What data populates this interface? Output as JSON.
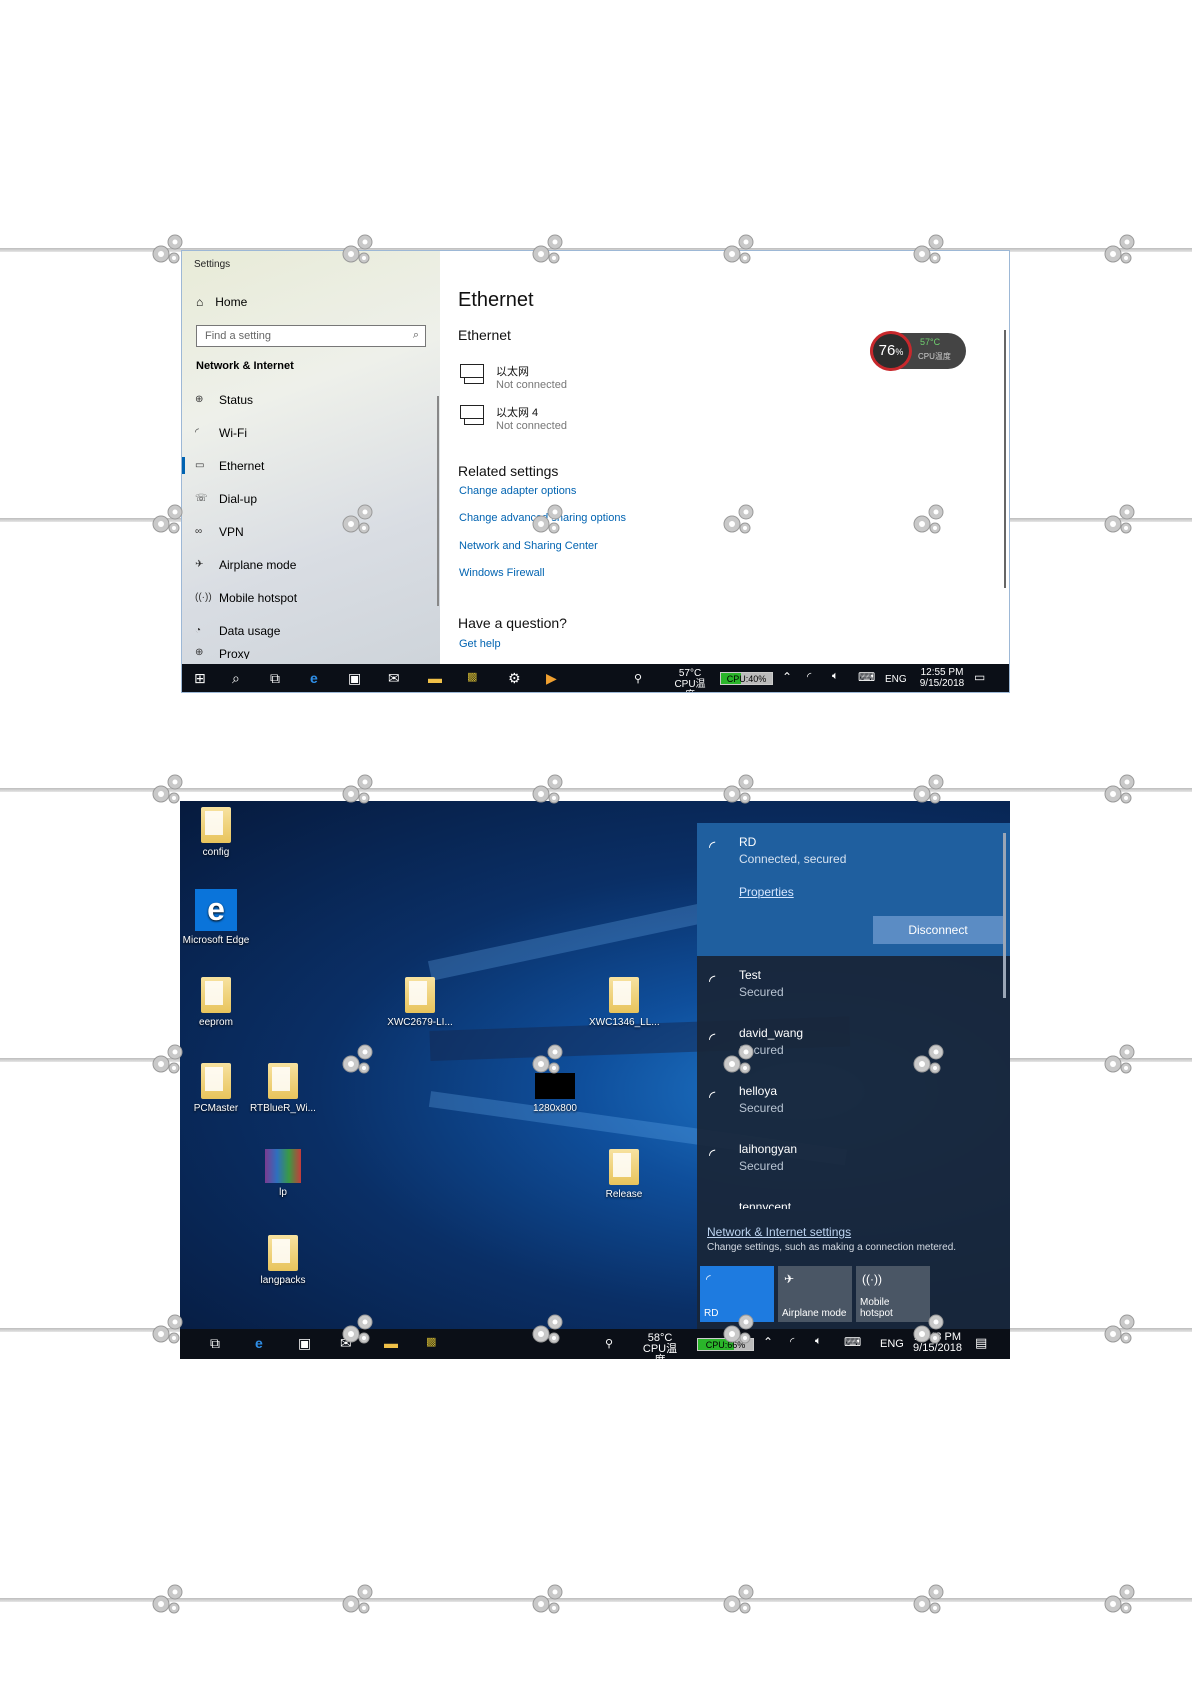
{
  "settings": {
    "window_title": "Settings",
    "home": "Home",
    "search_placeholder": "Find a setting",
    "section": "Network & Internet",
    "nav": [
      {
        "label": "Status",
        "icon": "globe-icon"
      },
      {
        "label": "Wi-Fi",
        "icon": "wifi-icon"
      },
      {
        "label": "Ethernet",
        "icon": "ethernet-icon",
        "active": true
      },
      {
        "label": "Dial-up",
        "icon": "phone-icon"
      },
      {
        "label": "VPN",
        "icon": "vpn-icon"
      },
      {
        "label": "Airplane mode",
        "icon": "airplane-icon"
      },
      {
        "label": "Mobile hotspot",
        "icon": "hotspot-icon"
      },
      {
        "label": "Data usage",
        "icon": "pie-icon"
      },
      {
        "label": "Proxy",
        "icon": "proxy-icon"
      }
    ],
    "page_title": "Ethernet",
    "subheading": "Ethernet",
    "adapters": [
      {
        "name": "以太网",
        "status": "Not connected"
      },
      {
        "name": "以太网 4",
        "status": "Not connected"
      }
    ],
    "related_heading": "Related settings",
    "related_links": [
      "Change adapter options",
      "Change advanced sharing options",
      "Network and Sharing Center",
      "Windows Firewall"
    ],
    "question_heading": "Have a question?",
    "help_link": "Get help",
    "cpu_widget": {
      "value": "76",
      "unit": "%",
      "temp": "57°C",
      "label": "CPU温度"
    }
  },
  "taskbar1": {
    "temp": "57°C",
    "temp_label": "CPU温度",
    "cpu": "CPU:40%",
    "cpu_fraction": 0.4,
    "lang": "ENG",
    "time": "12:55 PM",
    "date": "9/15/2018"
  },
  "desktop": {
    "icons": [
      "config",
      "Microsoft Edge",
      "eeprom",
      "XWC2679-LI...",
      "XWC1346_LL...",
      "PCMaster",
      "RTBlueR_Wi...",
      "1280x800",
      "lp",
      "Release",
      "langpacks"
    ]
  },
  "flyout": {
    "connected": {
      "ssid": "RD",
      "status": "Connected, secured",
      "properties": "Properties",
      "disconnect": "Disconnect"
    },
    "networks": [
      {
        "ssid": "Test",
        "status": "Secured"
      },
      {
        "ssid": "david_wang",
        "status": "Secured"
      },
      {
        "ssid": "helloya",
        "status": "Secured"
      },
      {
        "ssid": "laihongyan",
        "status": "Secured"
      },
      {
        "ssid": "tennycent",
        "status": ""
      }
    ],
    "settings_link": "Network & Internet settings",
    "settings_sub": "Change settings, such as making a connection metered.",
    "tiles": [
      {
        "label": "RD",
        "active": true
      },
      {
        "label": "Airplane mode",
        "active": false
      },
      {
        "label": "Mobile hotspot",
        "active": false
      }
    ]
  },
  "taskbar2": {
    "temp": "58°C",
    "temp_label": "CPU温度",
    "cpu": "CPU:66%",
    "cpu_fraction": 0.66,
    "lang": "ENG",
    "time": "12:43 PM",
    "date": "9/15/2018"
  }
}
